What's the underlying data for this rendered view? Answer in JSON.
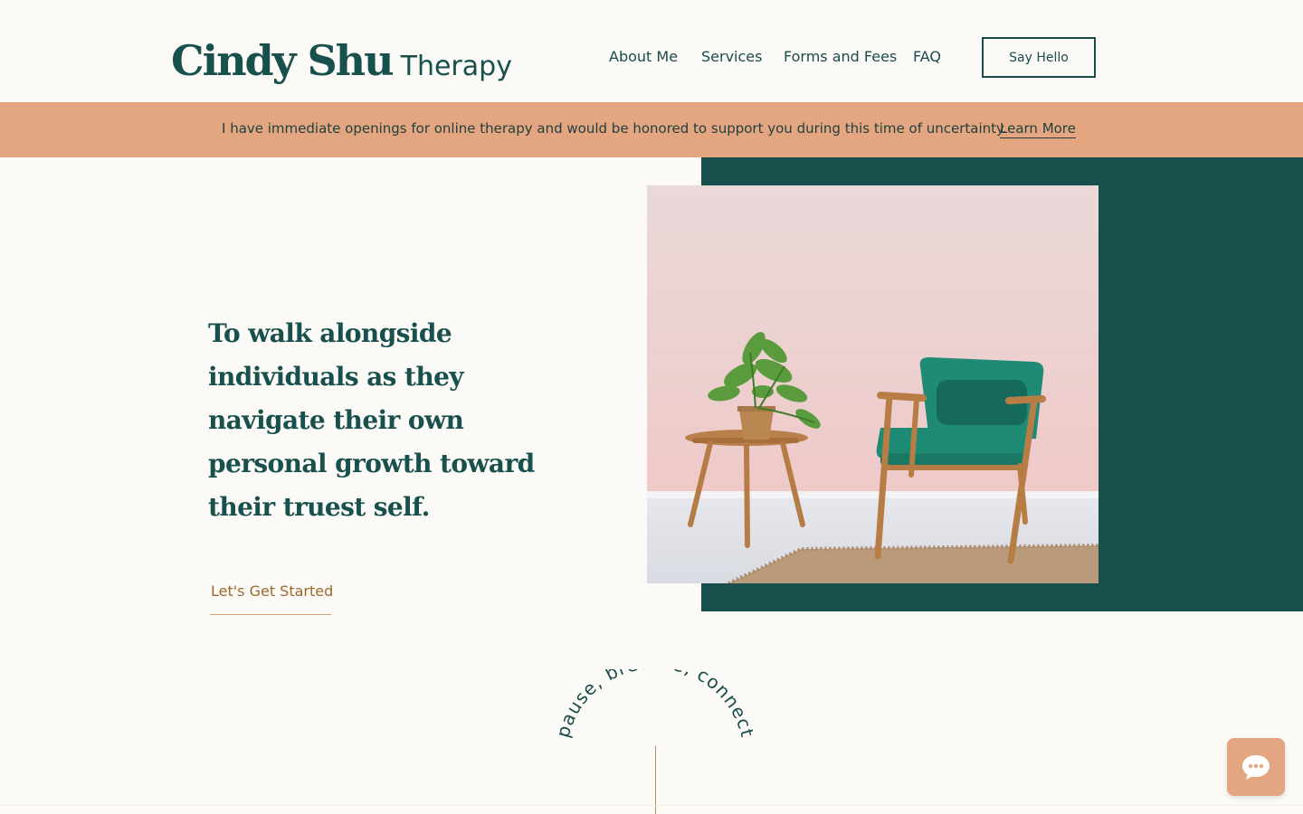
{
  "brand": {
    "name": "Cindy Shu",
    "suffix": "Therapy"
  },
  "nav": {
    "items": [
      {
        "label": "About Me"
      },
      {
        "label": "Services"
      },
      {
        "label": "Forms and Fees"
      },
      {
        "label": "FAQ"
      }
    ],
    "cta_label": "Say Hello"
  },
  "banner": {
    "text": "I have immediate openings for online therapy and would be honored to support you during this time of uncertainty.",
    "link_label": "Learn More"
  },
  "hero": {
    "heading": "To walk alongside individuals as they navigate their own personal growth toward their truest self.",
    "cta_label": "Let's Get Started"
  },
  "tagline": {
    "arc_text": "pause, breathe, connect"
  },
  "chat": {
    "icon": "chat-bubble-icon"
  },
  "colors": {
    "background": "#fcfaf6",
    "teal": "#174f4d",
    "peach": "#e4a680",
    "gold": "#9a6a2c"
  }
}
